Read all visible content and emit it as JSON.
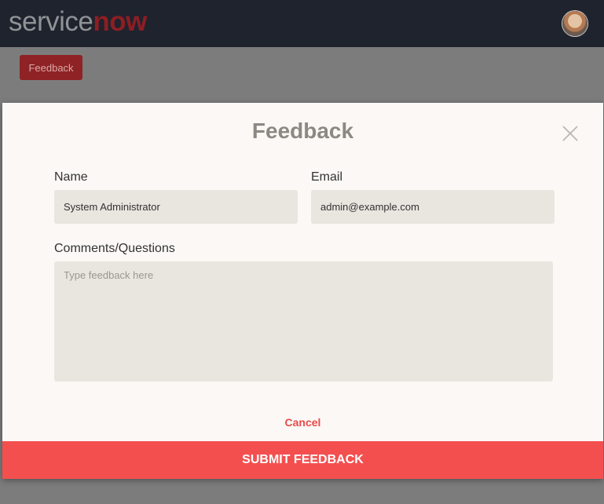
{
  "header": {
    "logo_service": "service",
    "logo_now": "now",
    "avatar_icon": "user-avatar"
  },
  "page": {
    "feedback_button_label": "Feedback"
  },
  "modal": {
    "title": "Feedback",
    "close_icon": "close-icon",
    "name_label": "Name",
    "name_value": "System Administrator",
    "email_label": "Email",
    "email_value": "admin@example.com",
    "comments_label": "Comments/Questions",
    "comments_placeholder": "Type feedback here",
    "cancel_label": "Cancel",
    "submit_label": "SUBMIT FEEDBACK"
  },
  "colors": {
    "header_bg": "#1f232d",
    "brand_red": "#8c1e24",
    "submit_bg": "#f44f4f",
    "cancel_text": "#e94b4b",
    "modal_bg": "#fbf8f5",
    "field_bg": "#e9e5df"
  }
}
